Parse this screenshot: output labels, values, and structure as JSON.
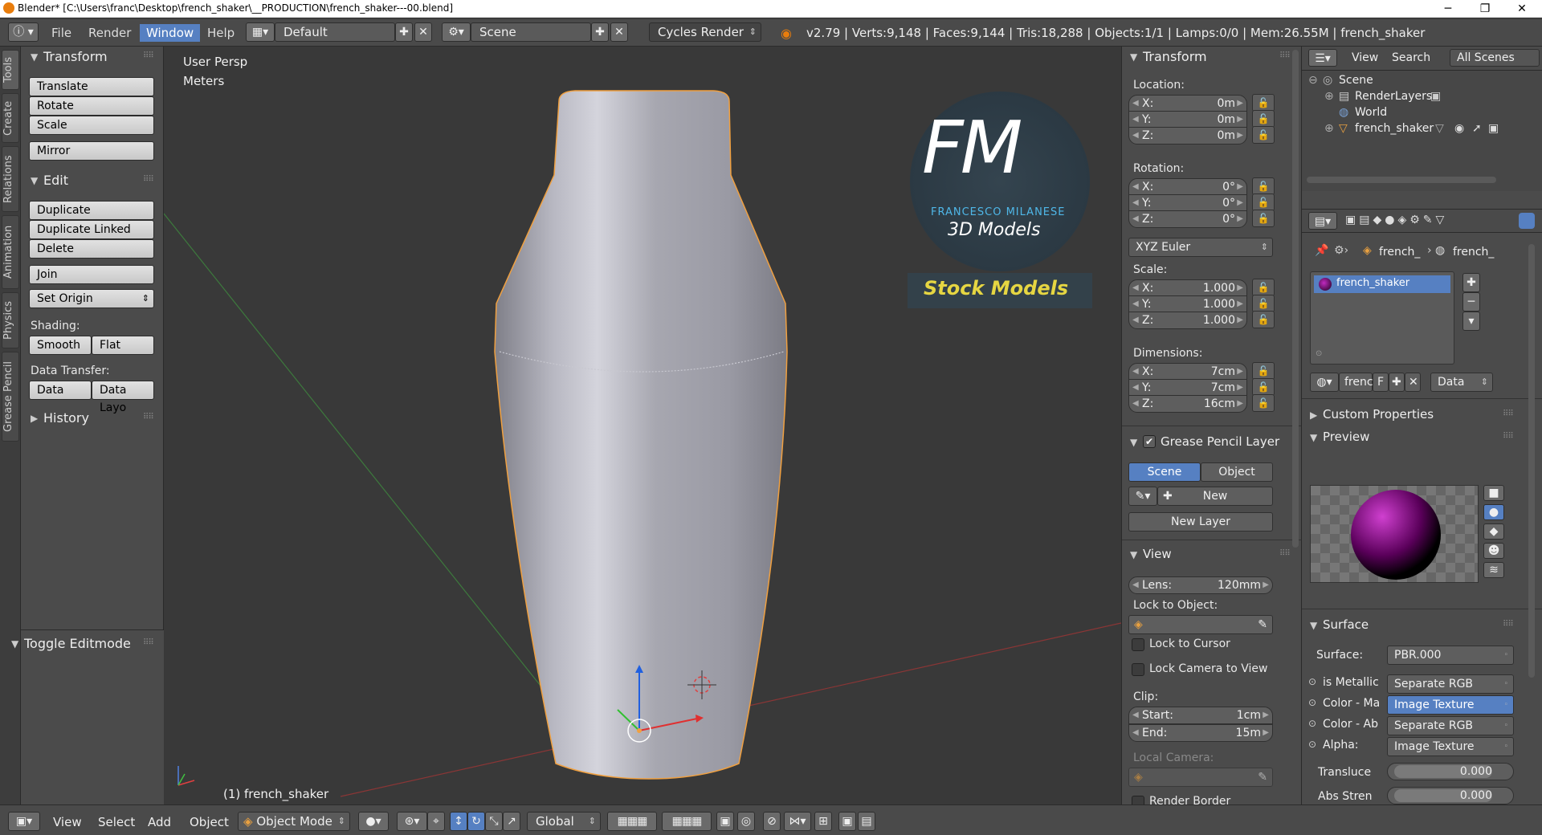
{
  "window": {
    "title": "Blender* [C:\\Users\\franc\\Desktop\\french_shaker\\__PRODUCTION\\french_shaker---00.blend]",
    "minimize": "─",
    "maximize": "❐",
    "close": "✕"
  },
  "topbar": {
    "menus": [
      "File",
      "Render",
      "Window",
      "Help"
    ],
    "layout": "Default",
    "scene": "Scene",
    "engine": "Cycles Render",
    "stats": "v2.79 | Verts:9,148 | Faces:9,144 | Tris:18,288 | Objects:1/1 | Lamps:0/0 | Mem:26.55M | french_shaker"
  },
  "tabs": [
    "Tools",
    "Create",
    "Relations",
    "Animation",
    "Physics",
    "Grease Pencil"
  ],
  "toolshelf": {
    "transform_title": "Transform",
    "translate": "Translate",
    "rotate": "Rotate",
    "scale": "Scale",
    "mirror": "Mirror",
    "edit_title": "Edit",
    "duplicate": "Duplicate",
    "duplicate_linked": "Duplicate Linked",
    "delete": "Delete",
    "join": "Join",
    "set_origin": "Set Origin",
    "shading_label": "Shading:",
    "smooth": "Smooth",
    "flat": "Flat",
    "data_transfer_label": "Data Transfer:",
    "data": "Data",
    "data_layo": "Data Layo",
    "history": "History",
    "toggle_editmode": "Toggle Editmode"
  },
  "viewport": {
    "view_name": "User Persp",
    "units": "Meters",
    "object_label": "(1) french_shaker",
    "logo_fm": "FM",
    "logo_name": "FRANCESCO MILANESE",
    "logo_sub": "3D Models",
    "stock": "Stock Models"
  },
  "npanel": {
    "transform_title": "Transform",
    "location_label": "Location:",
    "location": [
      {
        "k": "X:",
        "v": "0m"
      },
      {
        "k": "Y:",
        "v": "0m"
      },
      {
        "k": "Z:",
        "v": "0m"
      }
    ],
    "rotation_label": "Rotation:",
    "rotation": [
      {
        "k": "X:",
        "v": "0°"
      },
      {
        "k": "Y:",
        "v": "0°"
      },
      {
        "k": "Z:",
        "v": "0°"
      }
    ],
    "rotation_mode": "XYZ Euler",
    "scale_label": "Scale:",
    "scale": [
      {
        "k": "X:",
        "v": "1.000"
      },
      {
        "k": "Y:",
        "v": "1.000"
      },
      {
        "k": "Z:",
        "v": "1.000"
      }
    ],
    "dimensions_label": "Dimensions:",
    "dimensions": [
      {
        "k": "X:",
        "v": "7cm"
      },
      {
        "k": "Y:",
        "v": "7cm"
      },
      {
        "k": "Z:",
        "v": "16cm"
      }
    ],
    "gp_title": "Grease Pencil Layer",
    "gp_scene": "Scene",
    "gp_object": "Object",
    "gp_new": "New",
    "gp_new_layer": "New Layer",
    "view_title": "View",
    "lens_k": "Lens:",
    "lens_v": "120mm",
    "lock_obj_label": "Lock to Object:",
    "lock_cursor": "Lock to Cursor",
    "lock_camera": "Lock Camera to View",
    "clip_label": "Clip:",
    "clip_start_k": "Start:",
    "clip_start_v": "1cm",
    "clip_end_k": "End:",
    "clip_end_v": "15m",
    "local_camera": "Local Camera:",
    "render_border": "Render Border"
  },
  "outliner": {
    "view": "View",
    "search": "Search",
    "all_scenes": "All Scenes",
    "scene": "Scene",
    "render_layers": "RenderLayers",
    "world": "World",
    "object": "french_shaker"
  },
  "properties": {
    "crumb1": "french_",
    "crumb2": "french_",
    "material": "french_shaker",
    "mat_short": "frenc",
    "f_btn": "F",
    "data_sel": "Data",
    "custom_props": "Custom Properties",
    "preview": "Preview",
    "surface_title": "Surface",
    "surface_label": "Surface:",
    "surface_val": "PBR.000",
    "inputs": [
      {
        "k": "is Metallic",
        "v": "Separate RGB"
      },
      {
        "k": "Color - Ma",
        "v": "Image Texture"
      },
      {
        "k": "Color - Ab",
        "v": "Separate RGB"
      },
      {
        "k": "Alpha:",
        "v": "Image Texture"
      }
    ],
    "transluce_k": "Transluce",
    "transluce_v": "0.000",
    "abs_k": "Abs Stren",
    "abs_v": "0.000"
  },
  "bottombar": {
    "view": "View",
    "select": "Select",
    "add": "Add",
    "object": "Object",
    "mode": "Object Mode",
    "orientation": "Global"
  }
}
